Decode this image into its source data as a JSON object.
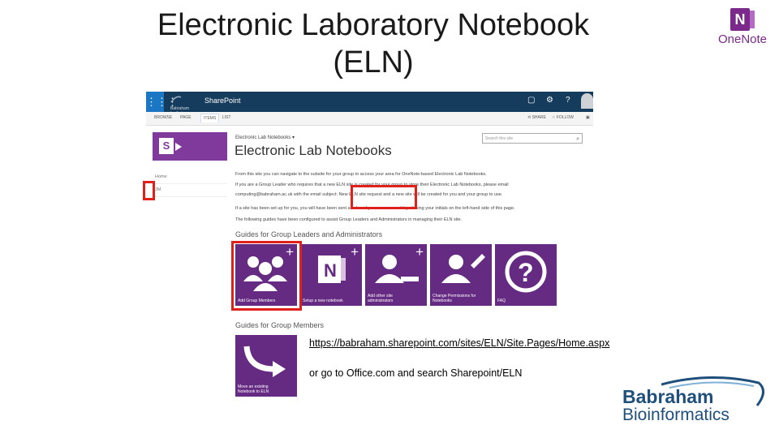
{
  "slide": {
    "title_line1": "Electronic Laboratory Notebook",
    "title_line2": "(ELN)",
    "url_text": "https://babraham.sharepoint.com/sites/ELN/Site.Pages/Home.aspx",
    "office_text": "or go to Office.com and search Sharepoint/ELN"
  },
  "logos": {
    "onenote_label": "OneNote",
    "onenote_letter": "N",
    "babraham_line1": "Babraham",
    "babraham_line2": "Bioinformatics",
    "institute_text": "Babraham Institute"
  },
  "sharepoint": {
    "app_label": "SharePoint",
    "waffle_icon": "⋮⋮⋮",
    "tabs": [
      "BROWSE",
      "PAGE",
      "ITEMS",
      "LIST"
    ],
    "active_tab": "ITEMS",
    "actions": {
      "share": "SHARE",
      "follow": "FOLLOW"
    },
    "breadcrumb": "Electronic Lab Notebooks",
    "page_title": "Electronic Lab Notebooks",
    "search_placeholder": "Search this site",
    "left_nav": [
      "Home",
      "JM"
    ],
    "body_lines": [
      "From this site you can navigate to the subsite for your group to access your area for OneNote-based Electronic Lab Notebooks.",
      "If you are a Group Leader who requires that a new ELN site is created for your group to store their Electronic Lab Notebooks, please email",
      "computing@babraham.ac.uk with the email subject: New ELN site request and a new site will be created for you and your group to use.",
      "If a site has been set up for you, you will have been sent a link and you can access it by clicking your initials on the left-hand side of this page.",
      "The following guides have been configured to assist Group Leaders and Administrators in managing their ELN site."
    ],
    "section_leaders": "Guides for Group Leaders and Administrators",
    "tiles": [
      {
        "caption": "Add Group Members",
        "icon": "group-icon"
      },
      {
        "caption": "Setup a new notebook",
        "icon": "onenote-icon"
      },
      {
        "caption": "Add other site administrators",
        "icon": "person-add-icon"
      },
      {
        "caption": "Change Permissions for Notebooks",
        "icon": "person-edit-icon"
      },
      {
        "caption": "FAQ",
        "icon": "question-icon"
      }
    ],
    "section_members": "Guides for Group Members",
    "member_tile": {
      "caption": "Move an existing Notebook to ELN",
      "icon": "arrow-icon"
    }
  },
  "colors": {
    "tile_purple": "#652a82",
    "suitebar": "#153c5c",
    "highlight_red": "#e0201b",
    "onenote_purple": "#7b2a8c",
    "babraham_blue": "#1f4f7c"
  }
}
